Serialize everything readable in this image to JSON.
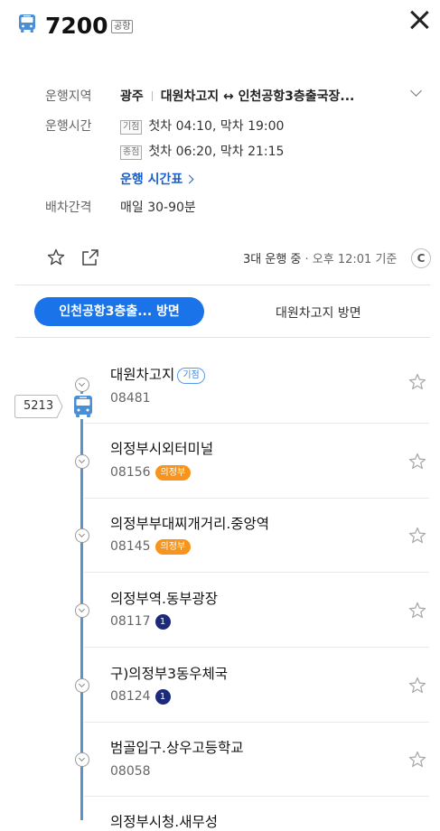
{
  "header": {
    "route_number": "7200",
    "route_type": "공항",
    "icon": "bus-icon"
  },
  "info": {
    "region_label": "운행지역",
    "region_from": "광주",
    "region_route": "대원차고지 ↔ 인천공항3층출국장...",
    "time_label": "운행시간",
    "start_badge": "기점",
    "start_times": "첫차 04:10, 막차 19:00",
    "end_badge": "종점",
    "end_times": "첫차 06:20, 막차 21:15",
    "timetable_link": "운행 시간표",
    "interval_label": "배차간격",
    "interval_value": "매일 30-90분"
  },
  "status": {
    "running": "3대 운행 중",
    "separator": " · ",
    "updated": "오후 12:01 기준",
    "refresh_label": "C"
  },
  "tabs": [
    {
      "label": "인천공항3층출... 방면",
      "active": true
    },
    {
      "label": "대원차고지 방면",
      "active": false
    }
  ],
  "bus_position": {
    "plate": "5213"
  },
  "stops": [
    {
      "name": "대원차고지",
      "code": "08481",
      "badge": "기점",
      "badge_type": "start"
    },
    {
      "name": "의정부시외터미널",
      "code": "08156",
      "badge": "의정부",
      "badge_type": "city"
    },
    {
      "name": "의정부부대찌개거리.중앙역",
      "code": "08145",
      "badge": "의정부",
      "badge_type": "city"
    },
    {
      "name": "의정부역.동부광장",
      "code": "08117",
      "badge": "1",
      "badge_type": "subway"
    },
    {
      "name": "구)의정부3동우체국",
      "code": "08124",
      "badge": "1",
      "badge_type": "subway"
    },
    {
      "name": "범골입구.상우고등학교",
      "code": "08058",
      "badge": "",
      "badge_type": "none"
    },
    {
      "name": "의정부시청.새무성",
      "code": "",
      "badge": "",
      "badge_type": "none"
    }
  ],
  "colors": {
    "accent": "#1a73e8",
    "route_line": "#5b93c9",
    "city_badge": "#f7941d",
    "subway_line1": "#1b2a7a"
  }
}
